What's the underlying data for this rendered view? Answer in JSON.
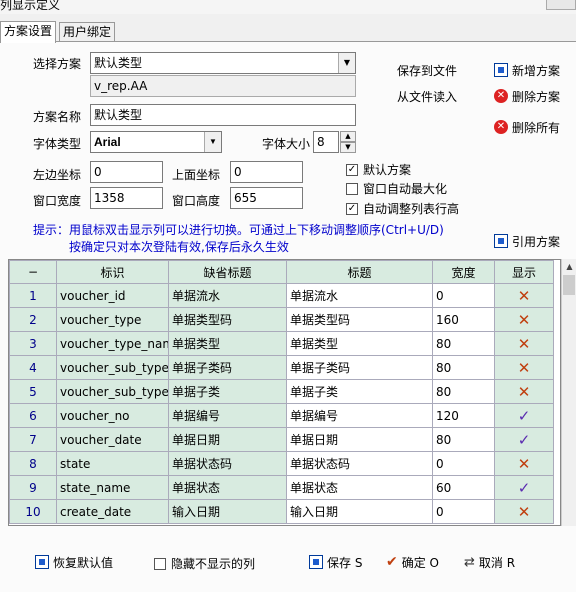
{
  "window": {
    "title": "列显示定义"
  },
  "tabs": [
    {
      "label": "方案设置"
    },
    {
      "label": "用户绑定"
    }
  ],
  "form": {
    "scheme_label": "选择方案",
    "scheme_value": "默认类型",
    "scheme_file": "v_rep.AA",
    "scheme_name_label": "方案名称",
    "scheme_name_value": "默认类型",
    "font_type_label": "字体类型",
    "font_type_value": "Arial",
    "font_size_label": "字体大小",
    "font_size_value": "8",
    "left_label": "左边坐标",
    "left_value": "0",
    "top_label": "上面坐标",
    "top_value": "0",
    "width_label": "窗口宽度",
    "width_value": "1358",
    "height_label": "窗口高度",
    "height_value": "655"
  },
  "actions": {
    "save_to_file": "保存到文件",
    "load_from_file": "从文件读入",
    "new_scheme": "新增方案",
    "delete_scheme": "删除方案",
    "delete_all": "删除所有",
    "apply_scheme": "引用方案"
  },
  "options": {
    "default_scheme": {
      "label": "默认方案",
      "checked": true
    },
    "auto_maximize": {
      "label": "窗口自动最大化",
      "checked": false
    },
    "auto_row_height": {
      "label": "自动调整列表行高",
      "checked": true
    }
  },
  "hints": {
    "line1": "提示：用鼠标双击显示列可以进行切换。可通过上下移动调整顺序(Ctrl+U/D)",
    "line2": "按确定只对本次登陆有效,保存后永久生效"
  },
  "grid": {
    "corner": "−",
    "headers": [
      "标识",
      "缺省标题",
      "标题",
      "宽度",
      "显示"
    ],
    "rows": [
      {
        "n": "1",
        "key": "voucher_id",
        "default": "单据流水",
        "title": "单据流水",
        "width": "0",
        "show": false
      },
      {
        "n": "2",
        "key": "voucher_type",
        "default": "单据类型码",
        "title": "单据类型码",
        "width": "160",
        "show": false
      },
      {
        "n": "3",
        "key": "voucher_type_nam",
        "default": "单据类型",
        "title": "单据类型",
        "width": "80",
        "show": false
      },
      {
        "n": "4",
        "key": "voucher_sub_type",
        "default": "单据子类码",
        "title": "单据子类码",
        "width": "80",
        "show": false
      },
      {
        "n": "5",
        "key": "voucher_sub_type",
        "default": "单据子类",
        "title": "单据子类",
        "width": "80",
        "show": false
      },
      {
        "n": "6",
        "key": "voucher_no",
        "default": "单据编号",
        "title": "单据编号",
        "width": "120",
        "show": true
      },
      {
        "n": "7",
        "key": "voucher_date",
        "default": "单据日期",
        "title": "单据日期",
        "width": "80",
        "show": true
      },
      {
        "n": "8",
        "key": "state",
        "default": "单据状态码",
        "title": "单据状态码",
        "width": "0",
        "show": false
      },
      {
        "n": "9",
        "key": "state_name",
        "default": "单据状态",
        "title": "单据状态",
        "width": "60",
        "show": true
      },
      {
        "n": "10",
        "key": "create_date",
        "default": "输入日期",
        "title": "输入日期",
        "width": "0",
        "show": false
      }
    ]
  },
  "bottom": {
    "restore_default": "恢复默认值",
    "hide_hidden": "隐藏不显示的列",
    "save": "保存 S",
    "ok": "确定 O",
    "cancel": "取消 R"
  },
  "colors": {
    "grid_header": "#d8ebe0",
    "hint": "#0000cc",
    "cross": "#c04010",
    "check": "#5a2bb0"
  }
}
